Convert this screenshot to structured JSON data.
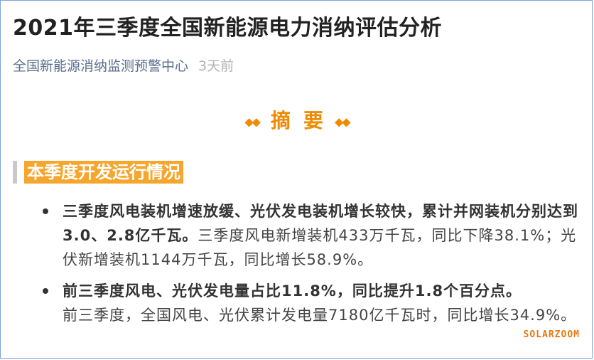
{
  "article": {
    "title": "2021年三季度全国新能源电力消纳评估分析",
    "source": "全国新能源消纳监测预警中心",
    "time": "3天前"
  },
  "abstract": {
    "label": "摘要",
    "left_ornament": "◆◆",
    "right_ornament": "◆◆"
  },
  "section": {
    "title": "本季度开发运行情况"
  },
  "bullets": [
    {
      "bold": "三季度风电装机增速放缓、光伏发电装机增长较快，累计并网装机分别达到3.0、2.8亿千瓦。",
      "text": "三季度风电新增装机433万千瓦，同比下降38.1%；光伏新增装机1144万千瓦，同比增长58.9%。"
    },
    {
      "bold": "前三季度风电、光伏发电量占比11.8%，同比提升1.8个百分点。",
      "text": "前三季度，全国风电、光伏累计发电量7180亿千瓦时，同比增长34.9%。"
    }
  ],
  "watermark": "SOLARZOOM",
  "colors": {
    "accent": "#f08a00",
    "section_bg": "#f6a52d",
    "border": "#7aa3d9"
  }
}
